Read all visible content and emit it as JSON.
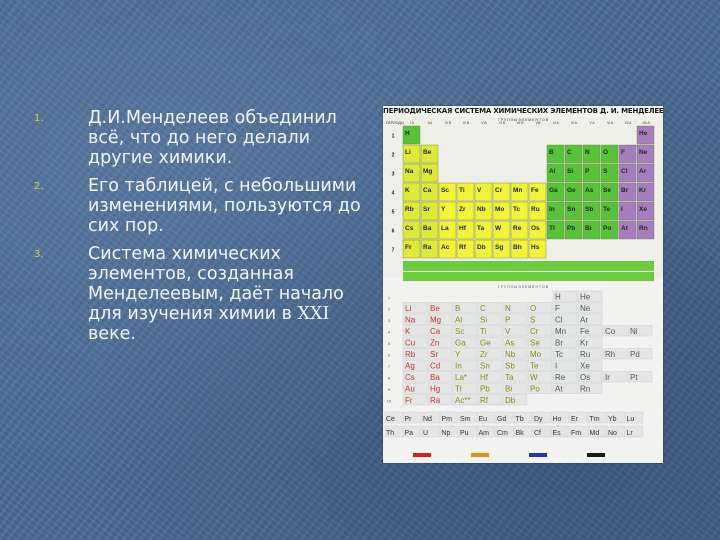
{
  "slide": {
    "items": [
      {
        "marker": "1.",
        "text": "Д.И.Менделеев объединил всё, что до него делали другие химики."
      },
      {
        "marker": "2.",
        "text": "Его таблицей, с небольшими изменениями, пользуются до сих пор."
      },
      {
        "marker": "3.",
        "text_before": "Система химических элементов, созданная Менделеевым, даёт начало для изучения химии в ",
        "text_roman": "XXI",
        "text_after": " веке."
      }
    ]
  },
  "poster": {
    "title": "ПЕРИОДИЧЕСКАЯ СИСТЕМА ХИМИЧЕСКИХ ЭЛЕМЕНТОВ Д. И. МЕНДЕЛЕЕВА",
    "groups_label": "Г Р У П П Ы   Э Л Е М Е Н Т О В",
    "periods_label": "ПЕРИОДЫ",
    "group_headers": [
      "I A",
      "II A",
      "III B",
      "IV B",
      "V B",
      "VI B",
      "VII B",
      "VIII",
      "III A",
      "IV A",
      "V A",
      "VI A",
      "VII A",
      "VIII A"
    ],
    "period_numbers": [
      "1",
      "2",
      "3",
      "4",
      "5",
      "6",
      "7"
    ],
    "top_rows": [
      [
        "H",
        "",
        "",
        "",
        "",
        "",
        "",
        "",
        "",
        "",
        "",
        "",
        "",
        "He"
      ],
      [
        "Li",
        "Be",
        "",
        "",
        "",
        "",
        "",
        "",
        "B",
        "C",
        "N",
        "O",
        "F",
        "Ne"
      ],
      [
        "Na",
        "Mg",
        "",
        "",
        "",
        "",
        "",
        "",
        "Al",
        "Si",
        "P",
        "S",
        "Cl",
        "Ar"
      ],
      [
        "K",
        "Ca",
        "Sc",
        "Ti",
        "V",
        "Cr",
        "Mn",
        "Fe",
        "Ga",
        "Ge",
        "As",
        "Se",
        "Br",
        "Kr"
      ],
      [
        "Rb",
        "Sr",
        "Y",
        "Zr",
        "Nb",
        "Mo",
        "Tc",
        "Ru",
        "In",
        "Sn",
        "Sb",
        "Te",
        "I",
        "Xe"
      ],
      [
        "Cs",
        "Ba",
        "La",
        "Hf",
        "Ta",
        "W",
        "Re",
        "Os",
        "Tl",
        "Pb",
        "Bi",
        "Po",
        "At",
        "Rn"
      ],
      [
        "Fr",
        "Ra",
        "Ac",
        "Rf",
        "Db",
        "Sg",
        "Bh",
        "Hs",
        "",
        "",
        "",
        "",
        "",
        ""
      ]
    ],
    "bottom_rows": [
      [
        "",
        "",
        "",
        "",
        "",
        "",
        "H",
        "He",
        "",
        ""
      ],
      [
        "Li",
        "Be",
        "B",
        "C",
        "N",
        "O",
        "F",
        "Ne",
        "",
        ""
      ],
      [
        "Na",
        "Mg",
        "Al",
        "Si",
        "P",
        "S",
        "Cl",
        "Ar",
        "",
        ""
      ],
      [
        "K",
        "Ca",
        "Sc",
        "Ti",
        "V",
        "Cr",
        "Mn",
        "Fe",
        "Co",
        "Ni"
      ],
      [
        "Cu",
        "Zn",
        "Ga",
        "Ge",
        "As",
        "Se",
        "Br",
        "Kr",
        "",
        ""
      ],
      [
        "Rb",
        "Sr",
        "Y",
        "Zr",
        "Nb",
        "Mo",
        "Tc",
        "Ru",
        "Rh",
        "Pd"
      ],
      [
        "Ag",
        "Cd",
        "In",
        "Sn",
        "Sb",
        "Te",
        "I",
        "Xe",
        "",
        ""
      ],
      [
        "Cs",
        "Ba",
        "La*",
        "Hf",
        "Ta",
        "W",
        "Re",
        "Os",
        "Ir",
        "Pt"
      ],
      [
        "Au",
        "Hg",
        "Tl",
        "Pb",
        "Bi",
        "Po",
        "At",
        "Rn",
        "",
        ""
      ],
      [
        "Fr",
        "Ra",
        "Ac**",
        "Rf",
        "Db",
        "",
        "",
        "",
        "",
        ""
      ]
    ],
    "lanthanides": [
      "Ce",
      "Pr",
      "Nd",
      "Pm",
      "Sm",
      "Eu",
      "Gd",
      "Tb",
      "Dy",
      "Ho",
      "Er",
      "Tm",
      "Yb",
      "Lu"
    ],
    "actinides": [
      "Th",
      "Pa",
      "U",
      "Np",
      "Pu",
      "Am",
      "Cm",
      "Bk",
      "Cf",
      "Es",
      "Fm",
      "Md",
      "No",
      "Lr"
    ],
    "legend_colors": [
      "#d81f1f",
      "#e98a1b",
      "#1f3aa8",
      "#1a1a1a"
    ]
  },
  "colors": {
    "background": "#4b6c95",
    "text": "#f2f5fa",
    "marker": "#d8d23a",
    "s_block": "#e0e83a",
    "p_block": "#58c23a",
    "d_block": "#e7ef2f",
    "noble": "#a67ec0",
    "halogen": "#b88ac9"
  }
}
